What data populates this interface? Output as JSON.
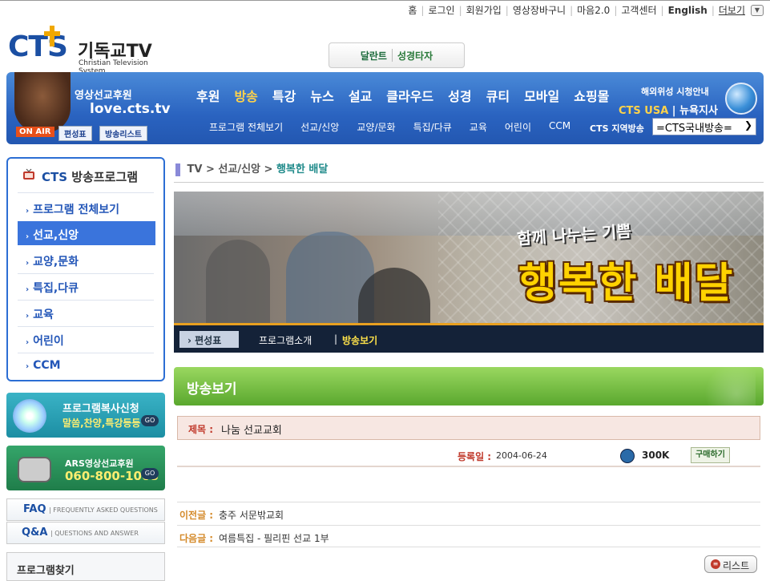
{
  "top_links": {
    "home": "홈",
    "login": "로그인",
    "join": "회원가입",
    "cart": "영상장바구니",
    "maum": "마음2.0",
    "support": "고객센터",
    "english": "English",
    "more": "더보기"
  },
  "logo": {
    "brand": "CTS",
    "name_kr": "기독교TV",
    "name_en": "Christian Television System"
  },
  "badges": {
    "item1": "달란트",
    "item2": "성경타자"
  },
  "nav": {
    "promo_line1": "영상선교후원",
    "promo_line2": "love.cts.tv",
    "on_air": "ON AIR",
    "schedule": "편성표",
    "broadcast_list": "방송리스트",
    "main_menu": [
      "후원",
      "방송",
      "특강",
      "뉴스",
      "설교",
      "클라우드",
      "성경",
      "큐티",
      "모바일",
      "쇼핑몰"
    ],
    "active_main": "방송",
    "sub_menu": [
      "프로그램 전체보기",
      "선교/신앙",
      "교양/문화",
      "특집/다큐",
      "교육",
      "어린이",
      "CCM"
    ],
    "overseas_line1": "해외위성 시청안내",
    "overseas_usa": "CTS USA",
    "overseas_ny": "뉴욕지사",
    "region_label": "CTS 지역방송",
    "region_selected": "=CTS국내방송="
  },
  "sidebar": {
    "title_prefix": "CTS",
    "title_rest": "방송프로그램",
    "items": [
      "프로그램 전체보기",
      "선교,신앙",
      "교양,문화",
      "특집,다큐",
      "교육",
      "어린이",
      "CCM"
    ],
    "active_item": "선교,신앙",
    "promo_copy": {
      "line1": "프로그램복사신청",
      "line2": "말씀,찬양,특강등등",
      "go": "GO"
    },
    "promo_ars": {
      "line1": "ARS영상선교후원",
      "line2": "060-800-1008",
      "go": "GO"
    },
    "faq": {
      "key": "FAQ",
      "sub": "| FREQUENTLY ASKED QUESTIONS"
    },
    "qna": {
      "key": "Q&A",
      "sub": "| QUESTIONS AND ANSWER"
    },
    "find_program": "프로그램찾기"
  },
  "breadcrumb": {
    "level1": "TV",
    "level2": "선교/신앙",
    "current": "행복한 배달"
  },
  "banner": {
    "subtitle": "함께 나누는 기쁨",
    "title": "행복한 배달"
  },
  "program_bar": {
    "schedule": "편성표",
    "intro": "프로그램소개",
    "separator": "|",
    "view": "방송보기"
  },
  "section_title": "방송보기",
  "detail": {
    "title_label": "제목 :",
    "title_value": "나눔 선교교회",
    "date_label": "등록일 :",
    "date_value": "2004-06-24",
    "size": "300K",
    "buy": "구매하기",
    "prev_label": "이전글 :",
    "prev_value": "충주 서문밖교회",
    "next_label": "다음글 :",
    "next_value": "여름특집 - 필리핀 선교 1부"
  },
  "list_button": "리스트",
  "colors": {
    "brand_blue": "#1b4fa3",
    "active_yellow": "#ffd34a",
    "section_green": "#5aa82e",
    "label_red": "#c0392b"
  }
}
